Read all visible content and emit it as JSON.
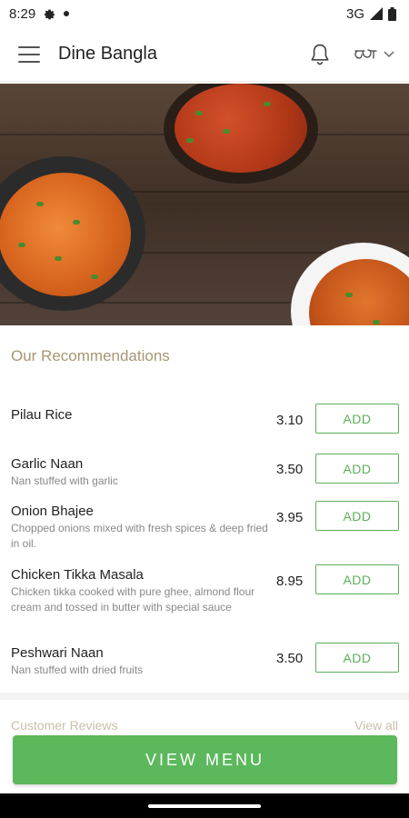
{
  "status": {
    "time": "8:29",
    "network": "3G"
  },
  "app": {
    "title": "Dine Bangla"
  },
  "recommendations": {
    "title": "Our Recommendations",
    "items": [
      {
        "name": "Pilau Rice",
        "desc": "",
        "price": "3.10",
        "add_label": "ADD"
      },
      {
        "name": "Garlic Naan",
        "desc": "Nan stuffed with garlic",
        "price": "3.50",
        "add_label": "ADD"
      },
      {
        "name": "Onion Bhajee",
        "desc": "Chopped onions mixed with fresh spices & deep fried in oil.",
        "price": "3.95",
        "add_label": "ADD"
      },
      {
        "name": "Chicken Tikka Masala",
        "desc": "Chicken tikka cooked with pure ghee, almond flour cream and tossed in butter with special sauce",
        "price": "8.95",
        "add_label": "ADD"
      },
      {
        "name": "Peshwari Naan",
        "desc": "Nan stuffed with dried fruits",
        "price": "3.50",
        "add_label": "ADD"
      }
    ]
  },
  "next_section": {
    "title": "Customer Reviews",
    "link": "View all"
  },
  "footer": {
    "view_menu_label": "VIEW MENU"
  },
  "colors": {
    "accent": "#5cb85c",
    "section_title": "#a69673"
  }
}
